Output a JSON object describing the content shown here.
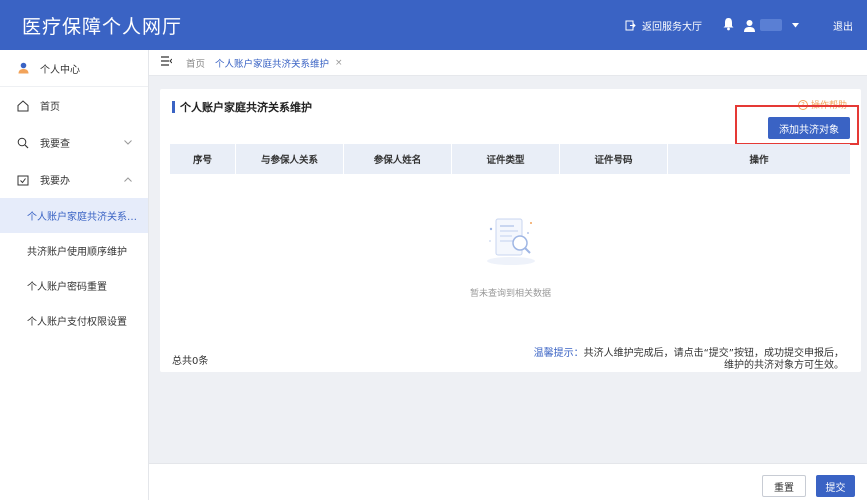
{
  "header": {
    "app_title": "医疗保障个人网厅",
    "back_to_hall": "返回服务大厅",
    "logout": "退出"
  },
  "sidebar": {
    "profile_label": "个人中心",
    "items": [
      {
        "label": "首页",
        "icon": "home-icon"
      },
      {
        "label": "我要查",
        "icon": "search-icon"
      },
      {
        "label": "我要办",
        "icon": "todo-icon"
      }
    ],
    "sub_items": [
      {
        "label": "个人账户家庭共济关系…"
      },
      {
        "label": "共济账户使用顺序维护"
      },
      {
        "label": "个人账户密码重置"
      },
      {
        "label": "个人账户支付权限设置"
      }
    ]
  },
  "tabs": {
    "home": "首页",
    "active": "个人账户家庭共济关系维护",
    "close": "×"
  },
  "card": {
    "title": "个人账户家庭共济关系维护",
    "help": "操作帮助",
    "add_button": "添加共济对象",
    "columns": [
      "序号",
      "与参保人关系",
      "参保人姓名",
      "证件类型",
      "证件号码",
      "操作"
    ],
    "empty_text": "暂未查询到相关数据",
    "total": "总共0条",
    "tip_label": "温馨提示：",
    "tip_line1": "共济人维护完成后，请点击“提交”按钮，成功提交申报后，",
    "tip_line2": "维护的共济对象方可生效。"
  },
  "actions": {
    "reset": "重置",
    "submit": "提交"
  },
  "colors": {
    "primary": "#3a63c4",
    "highlight_border": "#e53935",
    "help": "#f2a35a"
  }
}
